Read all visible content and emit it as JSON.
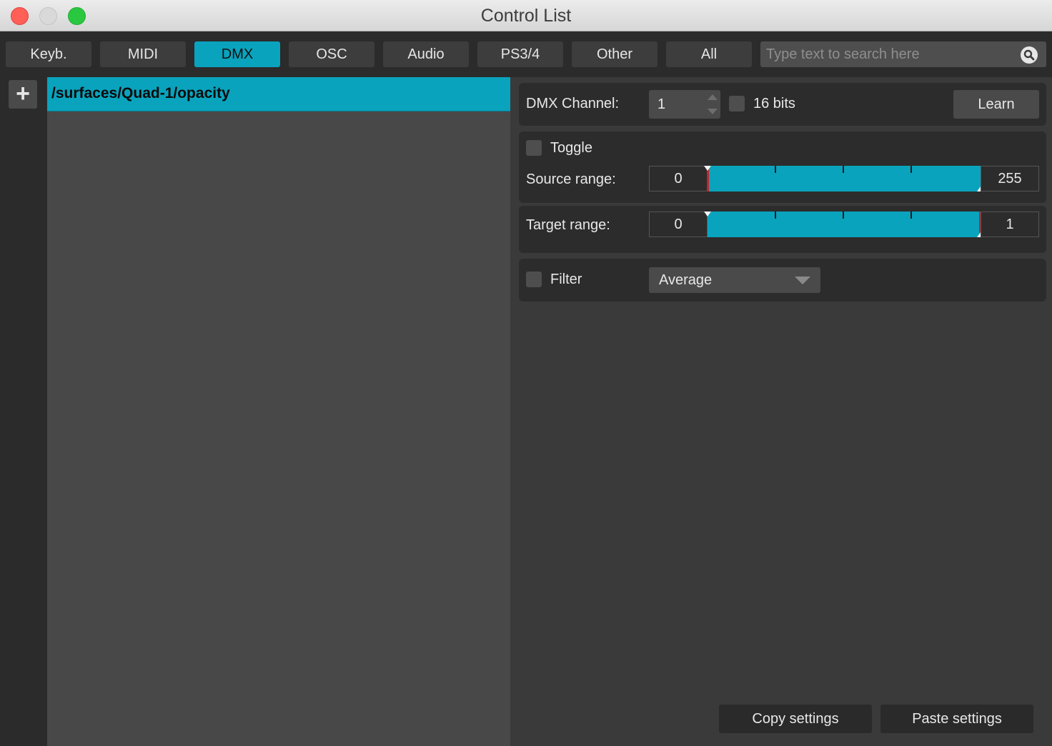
{
  "window": {
    "title": "Control List"
  },
  "tabs": [
    {
      "label": "Keyb.",
      "active": false
    },
    {
      "label": "MIDI",
      "active": false
    },
    {
      "label": "DMX",
      "active": true
    },
    {
      "label": "OSC",
      "active": false
    },
    {
      "label": "Audio",
      "active": false
    },
    {
      "label": "PS3/4",
      "active": false
    },
    {
      "label": "Other",
      "active": false
    },
    {
      "label": "All",
      "active": false
    }
  ],
  "search": {
    "placeholder": "Type text to search here",
    "icon": "search-icon"
  },
  "list": {
    "add_icon": "plus-icon",
    "items": [
      "/surfaces/Quad-1/opacity"
    ]
  },
  "dmx": {
    "channel_label": "DMX Channel:",
    "channel_value": "1",
    "bits_label": "16 bits",
    "bits_checked": false,
    "learn_label": "Learn"
  },
  "toggle": {
    "label": "Toggle",
    "checked": false
  },
  "source_range": {
    "label": "Source range:",
    "min": "0",
    "max": "255"
  },
  "target_range": {
    "label": "Target range:",
    "min": "0",
    "max": "1"
  },
  "filter": {
    "label": "Filter",
    "checked": false,
    "selected": "Average"
  },
  "footer": {
    "copy_label": "Copy settings",
    "paste_label": "Paste settings"
  },
  "colors": {
    "accent": "#0aa3bd",
    "marker": "#c0262b",
    "panel": "#3a3a3a"
  }
}
